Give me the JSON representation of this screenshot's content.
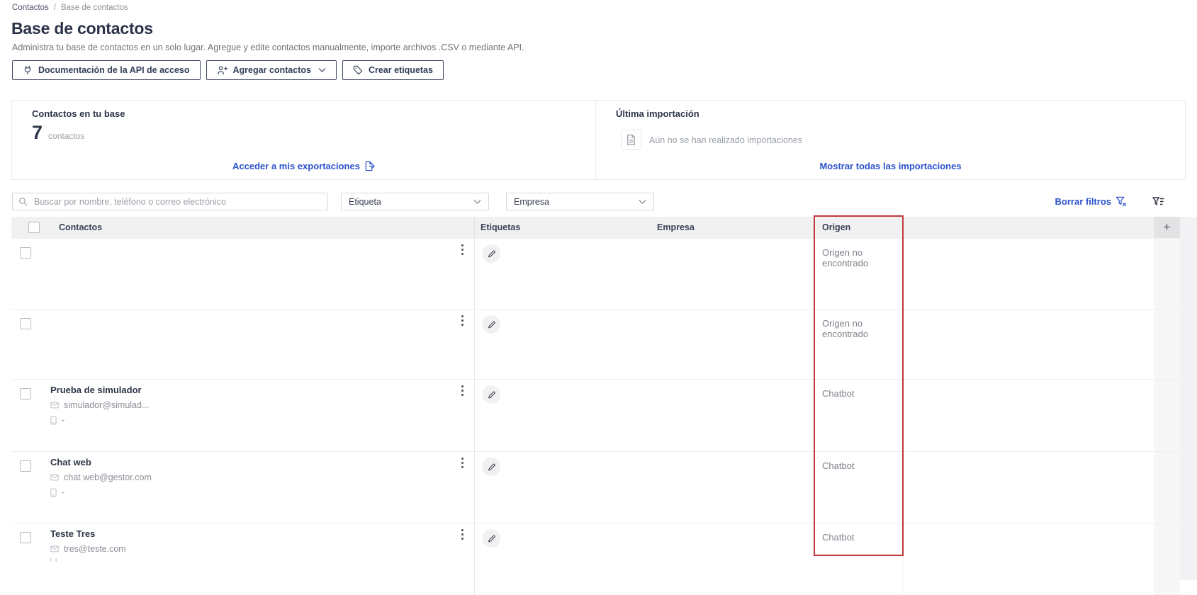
{
  "breadcrumb": {
    "items": [
      "Contactos",
      "Base de contactos"
    ],
    "separator": "/"
  },
  "header": {
    "title": "Base de contactos",
    "subtitle": "Administra tu base de contactos en un solo lugar. Agregue y edite contactos manualmente, importe archivos .CSV o mediante API.",
    "buttons": {
      "api_docs": "Documentación de la API de acceso",
      "add_contacts": "Agregar contactos",
      "create_tags": "Crear etiquetas"
    }
  },
  "summary": {
    "contacts_card": {
      "title": "Contactos en tu base",
      "count": "7",
      "count_label": "contactos",
      "export_link": "Acceder a mis exportaciones"
    },
    "import_card": {
      "title": "Última importación",
      "empty_message": "Aún no se han realizado importaciones",
      "link": "Mostrar todas las importaciones"
    }
  },
  "filters": {
    "search_placeholder": "Buscar por nombre, teléfono o correo electrónico",
    "tag_select": "Etiqueta",
    "company_select": "Empresa",
    "clear_filters": "Borrar filtros"
  },
  "table": {
    "columns": {
      "contacts": "Contactos",
      "tags": "Etiquetas",
      "company": "Empresa",
      "origin": "Origen",
      "add": "+"
    },
    "rows": [
      {
        "name": "",
        "email": "",
        "phone": "",
        "origin": "Origen no encontrado"
      },
      {
        "name": "",
        "email": "",
        "phone": "",
        "origin": "Origen no encontrado"
      },
      {
        "name": "Prueba de simulador",
        "email": "simulador@simulad...",
        "phone": "-",
        "origin": "Chatbot"
      },
      {
        "name": "Chat web",
        "email": "chat web@gestor.com",
        "phone": "-",
        "origin": "Chatbot"
      },
      {
        "name": "Teste Tres",
        "email": "tres@teste.com",
        "phone": "",
        "origin": "Chatbot"
      }
    ]
  },
  "icons": {
    "api_docs_button": "plug-icon",
    "add_contacts_button": "add-user-icon + chevron-down-icon",
    "create_tags_button": "tag-icon",
    "export_link": "export-document-icon",
    "last_import": "document-icon",
    "search": "search-icon",
    "clear_filters": "clear-filter-icon",
    "filter_panel": "filter-icon",
    "row_menu": "kebab-menu-icon",
    "edit_tags": "edit-pencil-icon",
    "email": "mail-icon",
    "phone": "phone-icon",
    "add_column": "plus-icon"
  },
  "colors": {
    "accent_blue": "#2b52cc",
    "dark_navy": "#2e3548",
    "muted_text": "#8b9097",
    "table_header_bg": "#f1f1f2",
    "red_highlight": "#c03a3a"
  }
}
